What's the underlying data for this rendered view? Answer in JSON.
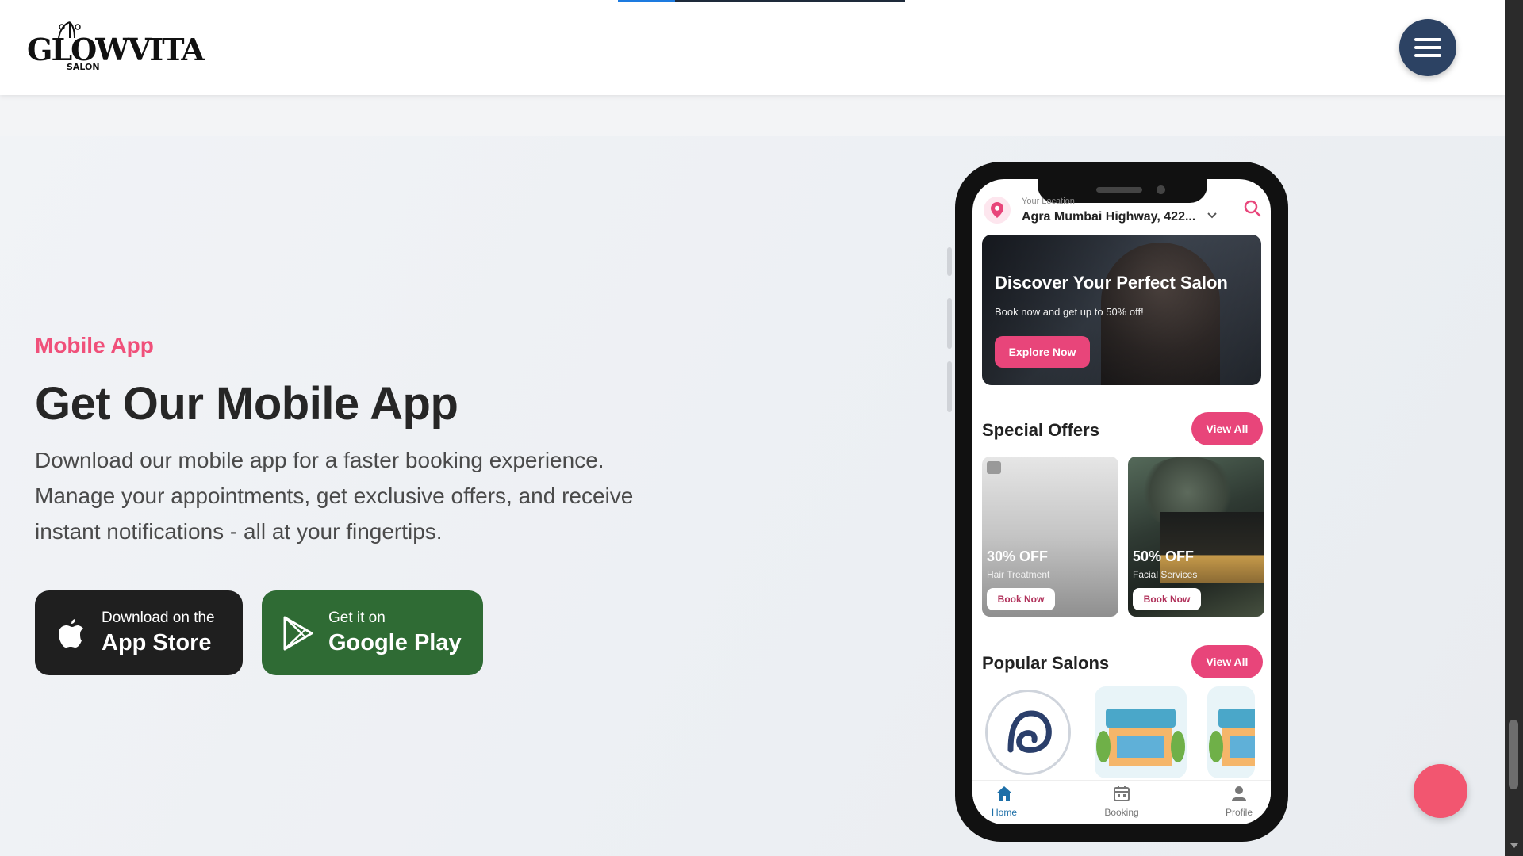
{
  "header": {
    "logo_text": "GLOWVITA",
    "logo_sub": "SALON",
    "scroll_progress": 0.2
  },
  "section": {
    "eyebrow": "Mobile App",
    "headline": "Get Our Mobile App",
    "description": "Download our mobile app for a faster booking experience. Manage your appointments, get exclusive offers, and receive instant notifications - all at your fingertips."
  },
  "buttons": {
    "app_store": {
      "small": "Download on the",
      "big": "App Store",
      "icon": "apple-icon"
    },
    "google_play": {
      "small": "Get it on",
      "big": "Google Play",
      "icon": "play-icon"
    }
  },
  "phone": {
    "location_label": "Your Location",
    "location_value": "Agra Mumbai Highway, 422...",
    "hero": {
      "title": "Discover Your Perfect Salon",
      "subtitle": "Book now and get up to 50% off!",
      "button": "Explore Now"
    },
    "special_offers": {
      "title": "Special Offers",
      "view_all": "View All",
      "items": [
        {
          "discount": "30% OFF",
          "name": "Hair Treatment",
          "button": "Book Now"
        },
        {
          "discount": "50% OFF",
          "name": "Facial Services",
          "button": "Book Now"
        }
      ]
    },
    "popular_salons": {
      "title": "Popular Salons",
      "view_all": "View All"
    },
    "nav": [
      {
        "label": "Home",
        "icon": "home-icon",
        "active": true
      },
      {
        "label": "Booking",
        "icon": "calendar-icon",
        "active": false
      },
      {
        "label": "Profile",
        "icon": "person-icon",
        "active": false
      }
    ]
  },
  "colors": {
    "accent": "#f0507a",
    "app_store_bg": "#1f1f1f",
    "google_play_bg": "#2f6b34",
    "menu_button_bg": "#2c4263",
    "fab": "#f25670"
  }
}
